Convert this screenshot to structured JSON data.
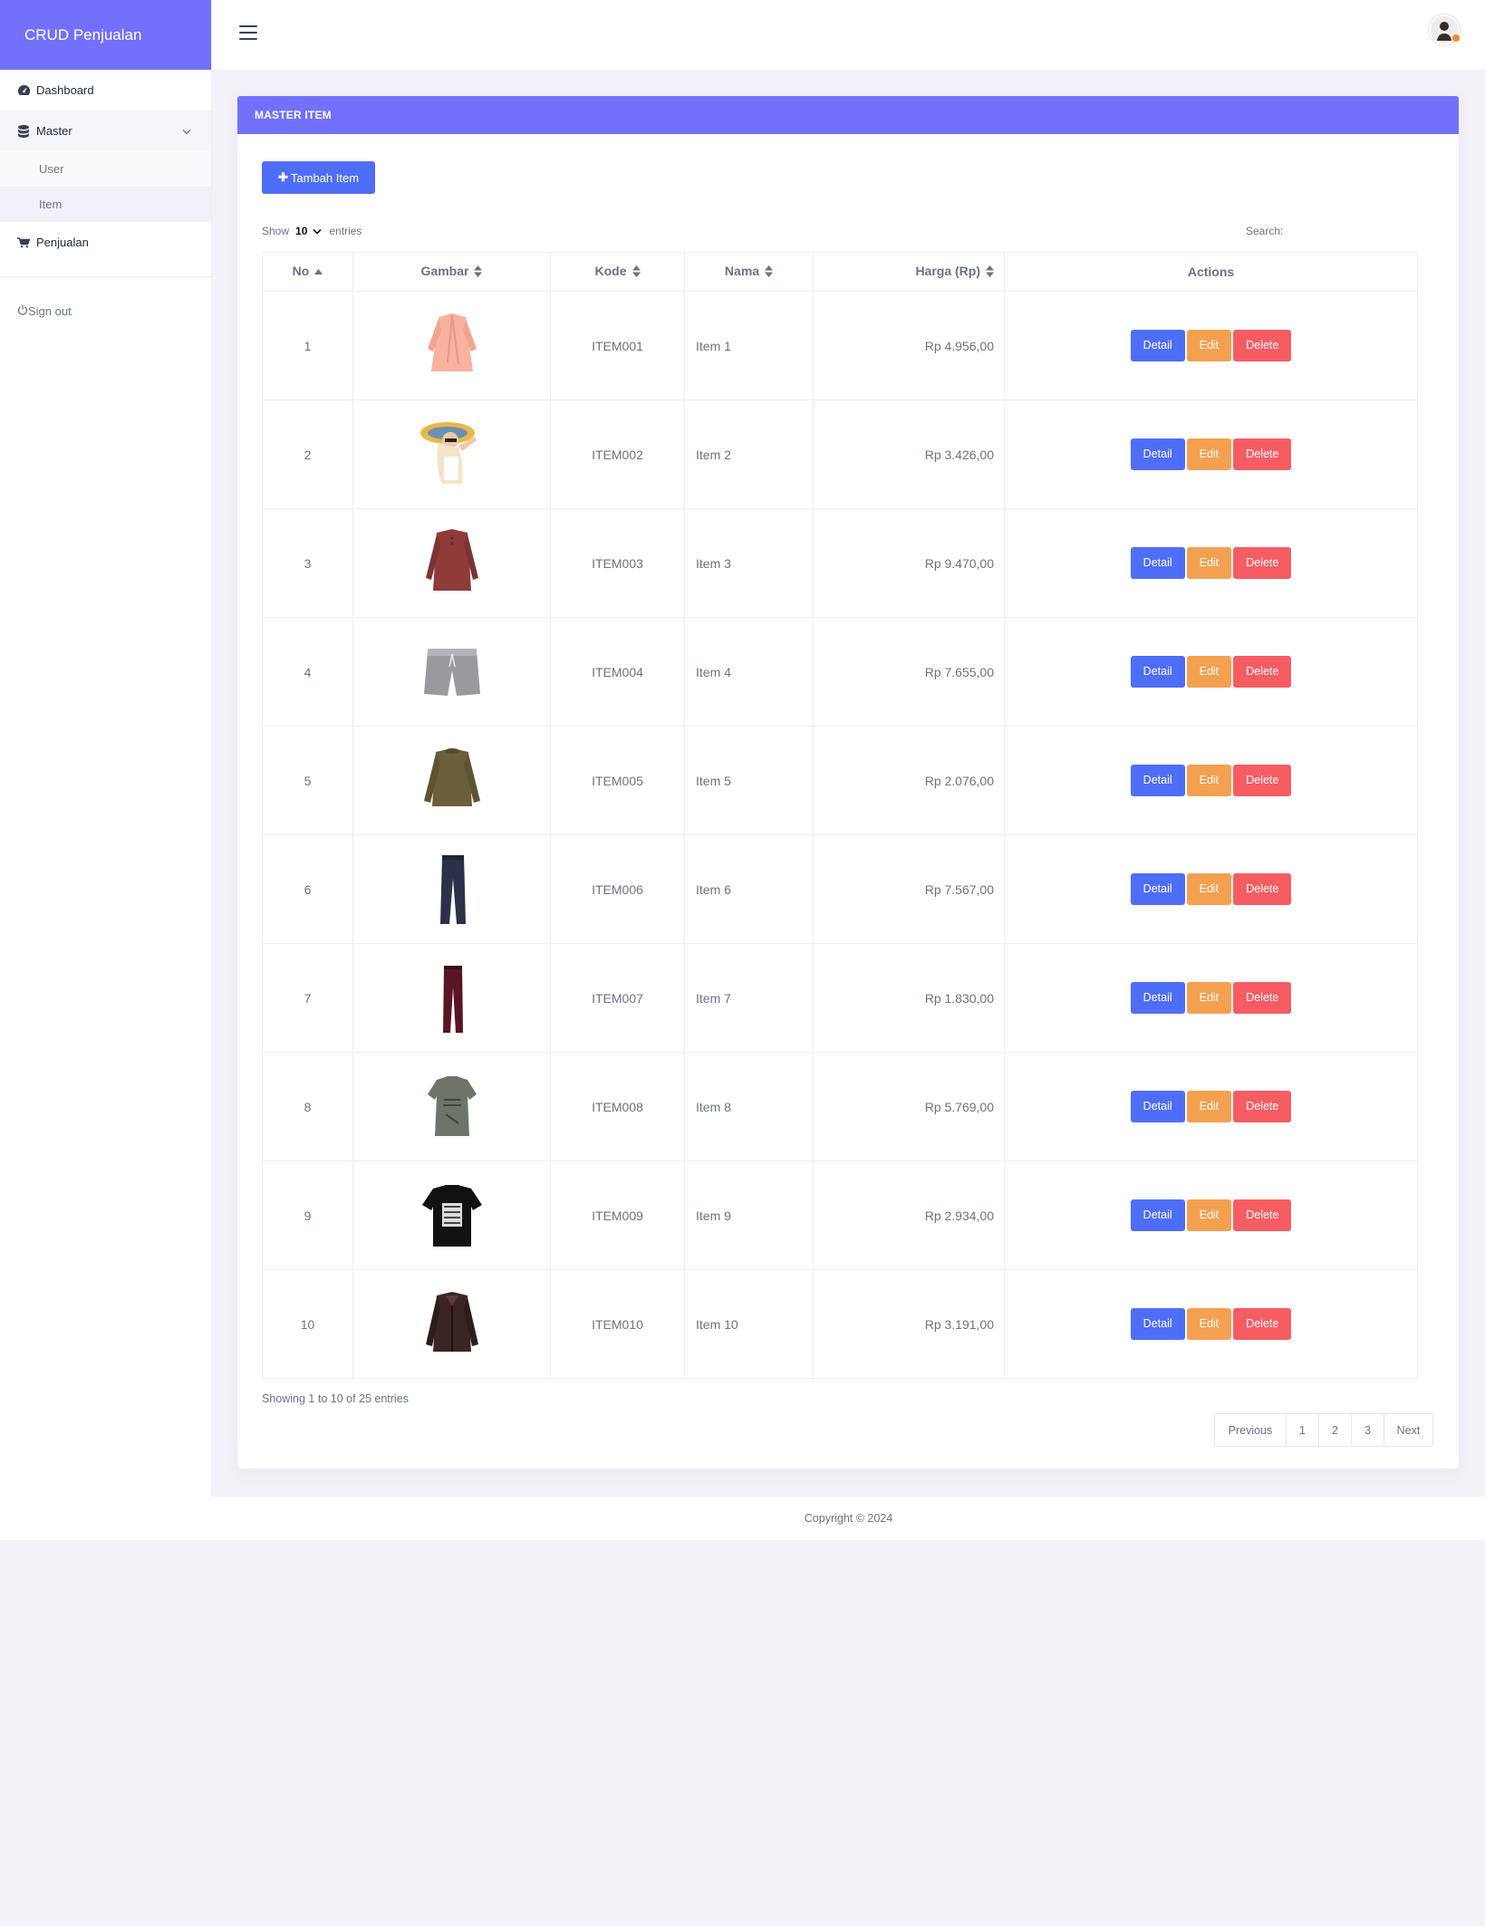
{
  "brand": "CRUD Penjualan",
  "sidebar": {
    "dashboard": "Dashboard",
    "master": "Master",
    "master_items": [
      "User",
      "Item"
    ],
    "penjualan": "Penjualan",
    "signout": "Sign out"
  },
  "card": {
    "title": "MASTER ITEM",
    "add_button": "Tambah Item",
    "show_label": "Show",
    "show_value": "10",
    "entries_label": "entries",
    "search_label": "Search:"
  },
  "table": {
    "headers": [
      "No",
      "Gambar",
      "Kode",
      "Nama",
      "Harga (Rp)",
      "Actions"
    ],
    "rows": [
      {
        "no": "1",
        "kode": "ITEM001",
        "nama": "Item 1",
        "harga": "Rp 4.956,00",
        "img": "pink-cardigan"
      },
      {
        "no": "2",
        "kode": "ITEM002",
        "nama": "Item 2",
        "harga": "Rp 3.426,00",
        "img": "woman-sun-hat"
      },
      {
        "no": "3",
        "kode": "ITEM003",
        "nama": "Item 3",
        "harga": "Rp 9.470,00",
        "img": "red-long-sleeve"
      },
      {
        "no": "4",
        "kode": "ITEM004",
        "nama": "Item 4",
        "harga": "Rp 7.655,00",
        "img": "grey-shorts"
      },
      {
        "no": "5",
        "kode": "ITEM005",
        "nama": "Item 5",
        "harga": "Rp 2.076,00",
        "img": "olive-sweater"
      },
      {
        "no": "6",
        "kode": "ITEM006",
        "nama": "Item 6",
        "harga": "Rp 7.567,00",
        "img": "navy-jeans"
      },
      {
        "no": "7",
        "kode": "ITEM007",
        "nama": "Item 7",
        "harga": "Rp 1.830,00",
        "img": "burgundy-pants"
      },
      {
        "no": "8",
        "kode": "ITEM008",
        "nama": "Item 8",
        "harga": "Rp 5.769,00",
        "img": "grey-tshirt"
      },
      {
        "no": "9",
        "kode": "ITEM009",
        "nama": "Item 9",
        "harga": "Rp 2.934,00",
        "img": "black-print-tshirt"
      },
      {
        "no": "10",
        "kode": "ITEM010",
        "nama": "Item 10",
        "harga": "Rp 3.191,00",
        "img": "leather-jacket"
      }
    ],
    "actions": {
      "detail": "Detail",
      "edit": "Edit",
      "delete": "Delete"
    }
  },
  "info": "Showing 1 to 10 of 25 entries",
  "pagination": {
    "previous": "Previous",
    "pages": [
      "1",
      "2",
      "3"
    ],
    "next": "Next"
  },
  "footer": "Copyright © 2024",
  "colors": {
    "accent": "#7371fc",
    "primary": "#4f6ef7",
    "warning": "#f4a051",
    "danger": "#f65d63"
  }
}
